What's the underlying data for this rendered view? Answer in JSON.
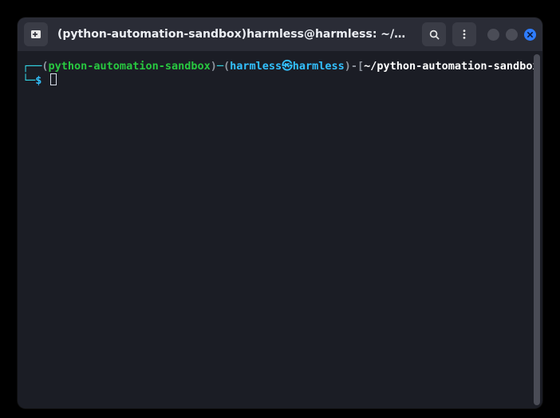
{
  "window": {
    "title": "(python-automation-sandbox)harmless@harmless: ~/pyth…"
  },
  "titlebar": {
    "buttons": {
      "new_tab_icon": "new-tab-icon",
      "search_icon": "search-icon",
      "menu_icon": "menu-icon"
    }
  },
  "window_controls": {
    "minimize": "minimize",
    "maximize": "maximize",
    "close": "close"
  },
  "prompt": {
    "line1": {
      "box_tl": "┌──",
      "paren_open1": "(",
      "venv": "python-automation-sandbox",
      "paren_close1": ")",
      "dash": "─",
      "paren_open2": "(",
      "user": "harmless",
      "skull": "㉿",
      "host": "harmless",
      "paren_close2": ")",
      "dash_bracket": "-[",
      "cwd": "~/python-automation-sandbox",
      "bracket_close_not_shown": ""
    },
    "line2": {
      "box_bl": "└─",
      "dollar": "$"
    }
  },
  "command_input": ""
}
